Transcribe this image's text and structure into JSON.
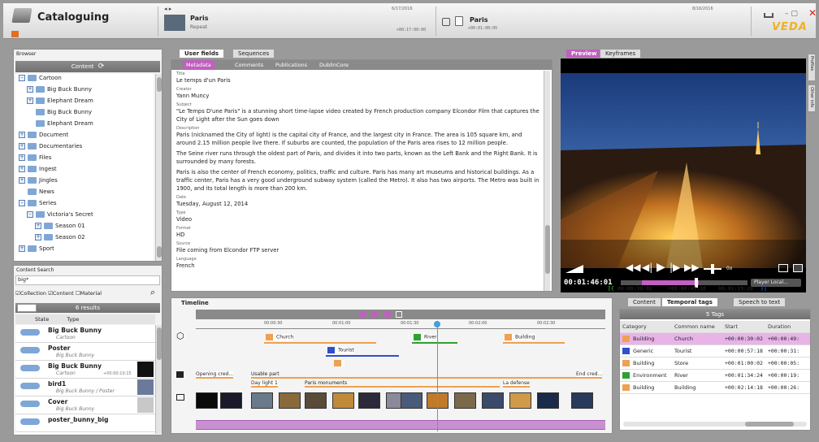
{
  "app": {
    "title": "Cataloguing",
    "logo": "VEDA"
  },
  "header": {
    "item1": {
      "title": "Paris",
      "subtitle": "Repeat"
    },
    "date1": "6/17/2016",
    "tc1": "+00:17:00:00",
    "item2": {
      "title": "Paris",
      "tc": "+00:01:00:05"
    },
    "date2": "8/16/2016"
  },
  "browser": {
    "title": "Browser",
    "bar": "Content",
    "tree": [
      {
        "label": "Cartoon",
        "level": 1,
        "exp": "-"
      },
      {
        "label": "Big Buck Bunny",
        "level": 2,
        "exp": "+"
      },
      {
        "label": "Elephant Dream",
        "level": 2,
        "exp": "+"
      },
      {
        "label": "Big Buck Bunny",
        "level": 2,
        "exp": ""
      },
      {
        "label": "Elephant Dream",
        "level": 2,
        "exp": ""
      },
      {
        "label": "Document",
        "level": 1,
        "exp": "+"
      },
      {
        "label": "Documentaries",
        "level": 1,
        "exp": "+"
      },
      {
        "label": "Files",
        "level": 1,
        "exp": "+"
      },
      {
        "label": "Ingest",
        "level": 1,
        "exp": "+"
      },
      {
        "label": "Jingles",
        "level": 1,
        "exp": "+"
      },
      {
        "label": "News",
        "level": 1,
        "exp": ""
      },
      {
        "label": "Series",
        "level": 1,
        "exp": "-"
      },
      {
        "label": "Victoria's Secret",
        "level": 2,
        "exp": "-"
      },
      {
        "label": "Season 01",
        "level": 3,
        "exp": "+"
      },
      {
        "label": "Season 02",
        "level": 3,
        "exp": "+"
      },
      {
        "label": "Sport",
        "level": 1,
        "exp": "+"
      }
    ]
  },
  "search": {
    "title": "Content Search",
    "query": "big*",
    "opt_collection": "Collection",
    "opt_content": "Content",
    "opt_material": "Material",
    "results_label": "6 results",
    "col_state": "State",
    "col_type": "Type",
    "results": [
      {
        "title": "Big Buck Bunny",
        "sub": "Cartoon",
        "tc": ""
      },
      {
        "title": "Poster",
        "sub": "Big Buck Bunny",
        "tc": ""
      },
      {
        "title": "Big Buck Bunny",
        "sub": "Cartoon",
        "tc": "+00:00:10:15"
      },
      {
        "title": "bird1",
        "sub": "Big Buck Bunny / Poster",
        "tc": ""
      },
      {
        "title": "Cover",
        "sub": "Big Buck Bunny",
        "tc": ""
      },
      {
        "title": "poster_bunny_big",
        "sub": "",
        "tc": ""
      }
    ]
  },
  "fields": {
    "tabs": [
      "User fields",
      "Sequences"
    ],
    "subtabs": [
      "Metadata",
      "Comments",
      "Publications",
      "DublinCore"
    ],
    "items": [
      {
        "label": "Title",
        "value": "Le temps d'un Paris"
      },
      {
        "label": "Creator",
        "value": "Yann Muncy"
      },
      {
        "label": "Subject",
        "value": "\"Le Temps D'une Paris\" is a stunning short time-lapse video created by French production company Elcondor Film that captures the City of Light after the Sun goes down"
      },
      {
        "label": "Description",
        "value": "Paris (nicknamed the City of light) is the capital city of France, and the largest city in France. The area is 105 square km, and around 2.15 million people live there. If suburbs are counted, the population of the Paris area rises to 12 million people."
      },
      {
        "label": "",
        "value": "The Seine river runs through the oldest part of Paris, and divides it into two parts, known as the Left Bank and the Right Bank. It is surrounded by many forests."
      },
      {
        "label": "",
        "value": "Paris is also the center of French economy, politics, traffic and culture. Paris has many art museums and historical buildings. As a traffic center, Paris has a very good underground subway system (called the Metro). It also has two airports. The Metro was built in 1900, and its total length is more than 200 km."
      },
      {
        "label": "Date",
        "value": "Tuesday, August 12, 2014"
      },
      {
        "label": "Type",
        "value": "Video"
      },
      {
        "label": "Format",
        "value": "HD"
      },
      {
        "label": "Source",
        "value": "File coming from Elcondor FTP server"
      },
      {
        "label": "Language",
        "value": "French"
      }
    ]
  },
  "preview": {
    "tabs": [
      "Preview",
      "Keyframes"
    ],
    "current_tc": "00:01:46:01",
    "in_tc": "00:00:30:02",
    "dur_tc": "+00:00:49:18",
    "out_tc": "00:01:19:20",
    "zoom": "0x",
    "player_btn": "Player Local...",
    "side_tabs": [
      "Profiles",
      "Other info"
    ]
  },
  "timeline": {
    "title": "Timeline",
    "ticks": [
      "00:00:30",
      "00:01:00",
      "00:01:30",
      "00:02:00",
      "00:02:30"
    ],
    "tags": {
      "church": "Church",
      "tourist": "Tourist",
      "river": "River",
      "building": "Building"
    },
    "segments": {
      "credits1": "Opening cred...",
      "usable": "Usable part",
      "daylight": "Day light 1",
      "monuments": "Paris monuments",
      "defense": "La defense",
      "credits2": "End cred..."
    }
  },
  "temporal": {
    "tabs": [
      "Content",
      "Temporal tags",
      "Speech to text"
    ],
    "bar": "5 Tags",
    "columns": [
      "Category",
      "Common name",
      "Start",
      "Duration"
    ],
    "rows": [
      {
        "category": "Building",
        "name": "Church",
        "start": "+00:00:30:02",
        "duration": "+00:00:49:"
      },
      {
        "category": "Generic",
        "name": "Tourist",
        "start": "+00:00:57:18",
        "duration": "+00:00:31:"
      },
      {
        "category": "Building",
        "name": "Store",
        "start": "+00:01:00:02",
        "duration": "+00:00:05:"
      },
      {
        "category": "Environment",
        "name": "River",
        "start": "+00:01:34:24",
        "duration": "+00:00:19:"
      },
      {
        "category": "Building",
        "name": "Building",
        "start": "+00:02:14:18",
        "duration": "+00:00:26:"
      }
    ]
  },
  "colors": {
    "accent": "#c060c0",
    "orange": "#f0a050",
    "blue": "#3050c8",
    "green": "#30a030",
    "logo": "#f0b020"
  }
}
